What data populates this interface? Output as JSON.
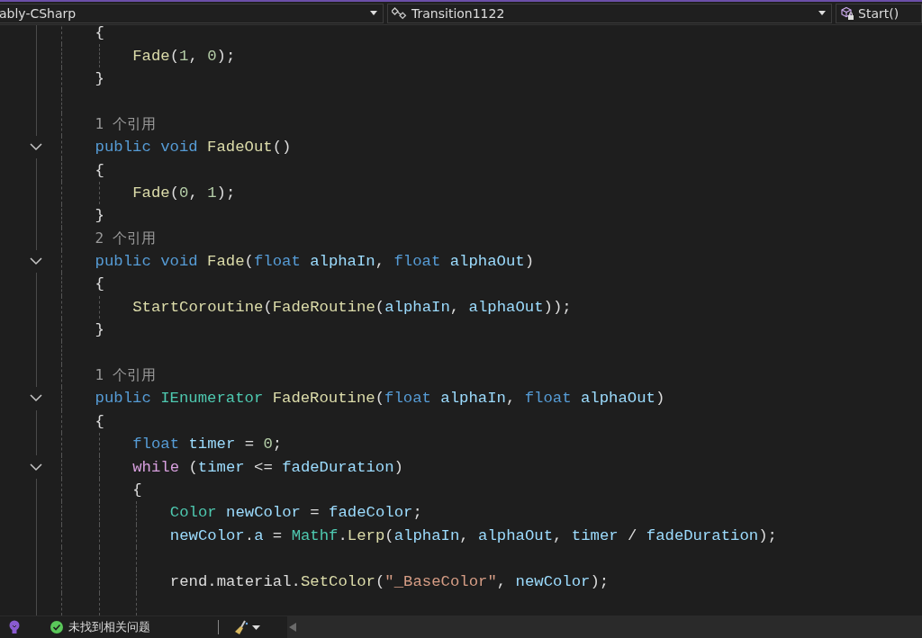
{
  "navigation_bar": {
    "dropdowns": [
      {
        "kind": "project",
        "label": "ably-CSharp"
      },
      {
        "kind": "class",
        "label": "Transition1122"
      },
      {
        "kind": "member",
        "label": "Start()"
      }
    ]
  },
  "editor": {
    "lines": [
      {
        "kind": "code",
        "fold": false,
        "tokens": [
          {
            "kind": "plain",
            "text": "{"
          }
        ],
        "children": [
          {
            "kind": "code",
            "fold": false,
            "tokens": [
              {
                "kind": "method",
                "text": "Fade"
              },
              {
                "kind": "plain",
                "text": "("
              },
              {
                "kind": "number",
                "text": "1"
              },
              {
                "kind": "plain",
                "text": ", "
              },
              {
                "kind": "number",
                "text": "0"
              },
              {
                "kind": "plain",
                "text": ");"
              }
            ]
          }
        ]
      },
      {
        "kind": "code",
        "fold": false,
        "tokens": [
          {
            "kind": "plain",
            "text": "}"
          }
        ]
      },
      {
        "kind": "blank",
        "fold": false
      },
      {
        "kind": "codelens",
        "fold": false,
        "text": "1 个引用"
      },
      {
        "kind": "code",
        "fold": true,
        "tokens": [
          {
            "kind": "keyword",
            "text": "public "
          },
          {
            "kind": "keyword",
            "text": "void "
          },
          {
            "kind": "method",
            "text": "FadeOut"
          },
          {
            "kind": "plain",
            "text": "()"
          }
        ]
      },
      {
        "kind": "code",
        "fold": false,
        "tokens": [
          {
            "kind": "plain",
            "text": "{"
          }
        ],
        "children": [
          {
            "kind": "code",
            "fold": false,
            "tokens": [
              {
                "kind": "method",
                "text": "Fade"
              },
              {
                "kind": "plain",
                "text": "("
              },
              {
                "kind": "number",
                "text": "0"
              },
              {
                "kind": "plain",
                "text": ", "
              },
              {
                "kind": "number",
                "text": "1"
              },
              {
                "kind": "plain",
                "text": ");"
              }
            ]
          }
        ]
      },
      {
        "kind": "code",
        "fold": false,
        "tokens": [
          {
            "kind": "plain",
            "text": "}"
          }
        ]
      },
      {
        "kind": "codelens",
        "fold": false,
        "text": "2 个引用"
      },
      {
        "kind": "code",
        "fold": true,
        "tokens": [
          {
            "kind": "keyword",
            "text": "public "
          },
          {
            "kind": "keyword",
            "text": "void "
          },
          {
            "kind": "method",
            "text": "Fade"
          },
          {
            "kind": "plain",
            "text": "("
          },
          {
            "kind": "keyword",
            "text": "float "
          },
          {
            "kind": "param",
            "text": "alphaIn"
          },
          {
            "kind": "plain",
            "text": ", "
          },
          {
            "kind": "keyword",
            "text": "float "
          },
          {
            "kind": "param",
            "text": "alphaOut"
          },
          {
            "kind": "plain",
            "text": ")"
          }
        ]
      },
      {
        "kind": "code",
        "fold": false,
        "tokens": [
          {
            "kind": "plain",
            "text": "{"
          }
        ],
        "children": [
          {
            "kind": "code",
            "fold": false,
            "tokens": [
              {
                "kind": "method",
                "text": "StartCoroutine"
              },
              {
                "kind": "plain",
                "text": "("
              },
              {
                "kind": "method",
                "text": "FadeRoutine"
              },
              {
                "kind": "plain",
                "text": "("
              },
              {
                "kind": "param",
                "text": "alphaIn"
              },
              {
                "kind": "plain",
                "text": ", "
              },
              {
                "kind": "param",
                "text": "alphaOut"
              },
              {
                "kind": "plain",
                "text": "));"
              }
            ]
          }
        ]
      },
      {
        "kind": "code",
        "fold": false,
        "tokens": [
          {
            "kind": "plain",
            "text": "}"
          }
        ]
      },
      {
        "kind": "blank",
        "fold": false
      },
      {
        "kind": "codelens",
        "fold": false,
        "text": "1 个引用"
      },
      {
        "kind": "code",
        "fold": true,
        "tokens": [
          {
            "kind": "keyword",
            "text": "public "
          },
          {
            "kind": "type",
            "text": "IEnumerator "
          },
          {
            "kind": "method",
            "text": "FadeRoutine"
          },
          {
            "kind": "plain",
            "text": "("
          },
          {
            "kind": "keyword",
            "text": "float "
          },
          {
            "kind": "param",
            "text": "alphaIn"
          },
          {
            "kind": "plain",
            "text": ", "
          },
          {
            "kind": "keyword",
            "text": "float "
          },
          {
            "kind": "param",
            "text": "alphaOut"
          },
          {
            "kind": "plain",
            "text": ")"
          }
        ]
      },
      {
        "kind": "code",
        "fold": false,
        "tokens": [
          {
            "kind": "plain",
            "text": "{"
          }
        ],
        "children": [
          {
            "kind": "code",
            "fold": false,
            "tokens": [
              {
                "kind": "keyword",
                "text": "float "
              },
              {
                "kind": "param",
                "text": "timer"
              },
              {
                "kind": "plain",
                "text": " = "
              },
              {
                "kind": "number",
                "text": "0"
              },
              {
                "kind": "plain",
                "text": ";"
              }
            ]
          },
          {
            "kind": "code",
            "fold": true,
            "tokens": [
              {
                "kind": "control",
                "text": "while"
              },
              {
                "kind": "plain",
                "text": " ("
              },
              {
                "kind": "param",
                "text": "timer"
              },
              {
                "kind": "plain",
                "text": " <= "
              },
              {
                "kind": "param",
                "text": "fadeDuration"
              },
              {
                "kind": "plain",
                "text": ")"
              }
            ]
          },
          {
            "kind": "code",
            "fold": false,
            "tokens": [
              {
                "kind": "plain",
                "text": "{"
              }
            ],
            "children": [
              {
                "kind": "code",
                "fold": false,
                "tokens": [
                  {
                    "kind": "type",
                    "text": "Color "
                  },
                  {
                    "kind": "param",
                    "text": "newColor"
                  },
                  {
                    "kind": "plain",
                    "text": " = "
                  },
                  {
                    "kind": "param",
                    "text": "fadeColor"
                  },
                  {
                    "kind": "plain",
                    "text": ";"
                  }
                ]
              },
              {
                "kind": "code",
                "fold": false,
                "tokens": [
                  {
                    "kind": "param",
                    "text": "newColor"
                  },
                  {
                    "kind": "plain",
                    "text": "."
                  },
                  {
                    "kind": "param",
                    "text": "a"
                  },
                  {
                    "kind": "plain",
                    "text": " = "
                  },
                  {
                    "kind": "type",
                    "text": "Mathf"
                  },
                  {
                    "kind": "plain",
                    "text": "."
                  },
                  {
                    "kind": "method",
                    "text": "Lerp"
                  },
                  {
                    "kind": "plain",
                    "text": "("
                  },
                  {
                    "kind": "param",
                    "text": "alphaIn"
                  },
                  {
                    "kind": "plain",
                    "text": ", "
                  },
                  {
                    "kind": "param",
                    "text": "alphaOut"
                  },
                  {
                    "kind": "plain",
                    "text": ", "
                  },
                  {
                    "kind": "param",
                    "text": "timer"
                  },
                  {
                    "kind": "plain",
                    "text": " / "
                  },
                  {
                    "kind": "param",
                    "text": "fadeDuration"
                  },
                  {
                    "kind": "plain",
                    "text": ");"
                  }
                ]
              },
              {
                "kind": "blank",
                "fold": false
              },
              {
                "kind": "code",
                "fold": false,
                "tokens": [
                  {
                    "kind": "plain",
                    "text": "rend.material."
                  },
                  {
                    "kind": "method",
                    "text": "SetColor"
                  },
                  {
                    "kind": "plain",
                    "text": "("
                  },
                  {
                    "kind": "string",
                    "text": "\"_BaseColor\""
                  },
                  {
                    "kind": "plain",
                    "text": ", "
                  },
                  {
                    "kind": "param",
                    "text": "newColor"
                  },
                  {
                    "kind": "plain",
                    "text": ");"
                  }
                ]
              },
              {
                "kind": "blank",
                "fold": false
              }
            ]
          }
        ]
      }
    ]
  },
  "status_bar": {
    "issues": "未找到相关问题"
  }
}
